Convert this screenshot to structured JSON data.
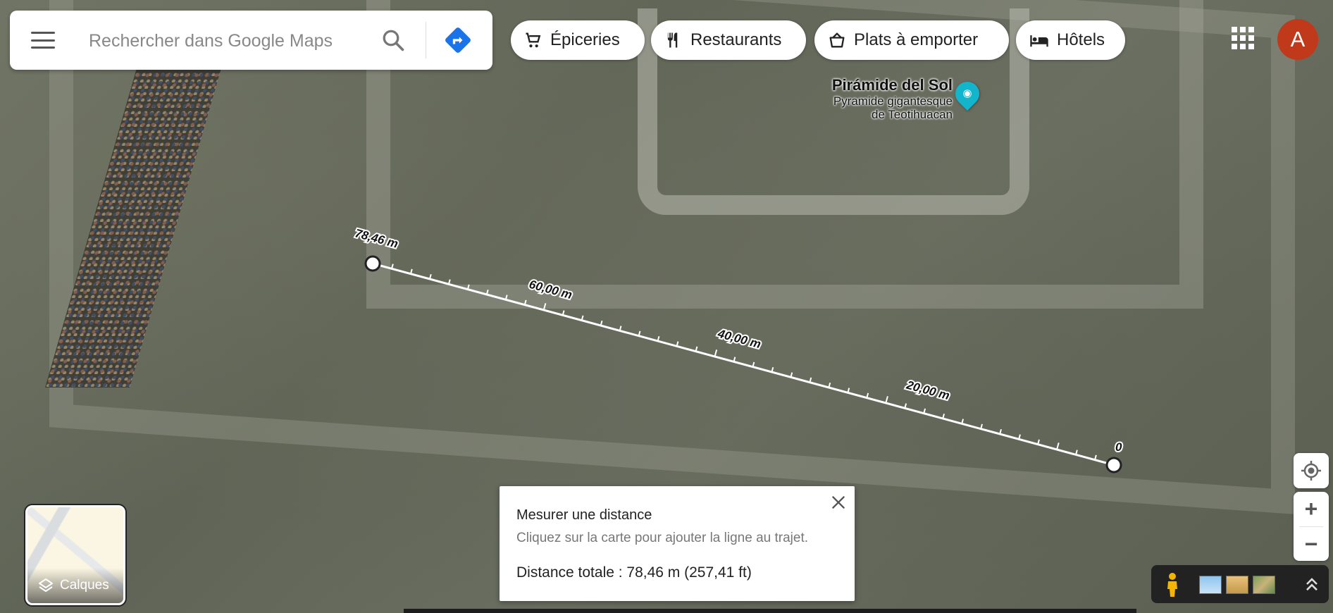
{
  "search": {
    "placeholder": "Rechercher dans Google Maps"
  },
  "chips": [
    {
      "label": "Épiceries",
      "icon": "cart-icon"
    },
    {
      "label": "Restaurants",
      "icon": "fork-knife-icon"
    },
    {
      "label": "Plats à emporter",
      "icon": "takeout-bag-icon"
    },
    {
      "label": "Hôtels",
      "icon": "bed-icon"
    }
  ],
  "account": {
    "initial": "A",
    "color": "#c0391b"
  },
  "poi": {
    "name": "Pirámide del Sol",
    "description_line1": "Pyramide gigantesque",
    "description_line2": "de Teotihuacan",
    "pin_color": "#12b5cb",
    "icon": "camera-icon"
  },
  "measurement": {
    "labels": [
      "78,46 m",
      "60,00 m",
      "40,00 m",
      "20,00 m",
      "0"
    ],
    "line_color": "#ffffff"
  },
  "panel": {
    "title": "Mesurer une distance",
    "hint": "Cliquez sur la carte pour ajouter la ligne au trajet.",
    "total": "Distance totale : 78,46 m (257,41 ft)"
  },
  "layers": {
    "label": "Calques"
  },
  "map_view": "satellite"
}
